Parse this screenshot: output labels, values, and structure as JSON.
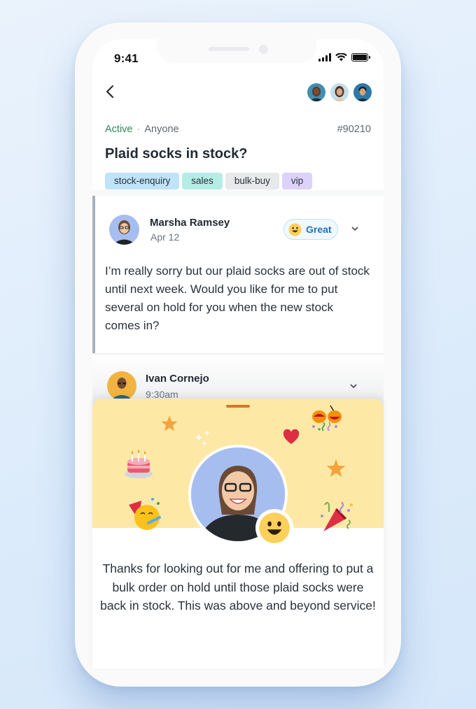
{
  "status_bar": {
    "time": "9:41"
  },
  "header": {
    "back_icon": "chevron-left-icon",
    "participants": [
      {
        "name": "participant-1",
        "color": "#2b6f8a"
      },
      {
        "name": "participant-2",
        "color": "#b9d6e2"
      },
      {
        "name": "participant-3",
        "color": "#2c79a8"
      }
    ]
  },
  "ticket": {
    "status": "Active",
    "separator": "·",
    "assignee": "Anyone",
    "id": "#90210",
    "title": "Plaid socks in stock?",
    "tags": [
      {
        "label": "stock-enquiry",
        "color": "#bfe3f8"
      },
      {
        "label": "sales",
        "color": "#b4ece6"
      },
      {
        "label": "bulk-buy",
        "color": "#e7e9eb"
      },
      {
        "label": "vip",
        "color": "#ddd2fa"
      }
    ]
  },
  "messages": [
    {
      "author": "Marsha Ramsey",
      "date": "Apr 12",
      "rating_label": "Great",
      "rating_icon": "grinning-face-icon",
      "body": "I’m really sorry but our plaid socks are out of stock until next week. Would you like for me to put several on hold for you when the new stock comes in?"
    },
    {
      "author": "Ivan Cornejo",
      "date": "9:30am"
    }
  ],
  "feedback_sheet": {
    "decorations": [
      "star-icon",
      "sparkles-icon",
      "heart-icon",
      "confetti-ball-icon",
      "birthday-cake-icon",
      "star-icon",
      "partying-face-icon",
      "party-popper-icon"
    ],
    "rating_icon": "grinning-face-icon",
    "quote": "Thanks for looking out for me and offering to put a bulk order on hold until those plaid socks were back in stock. This was above and beyond service!"
  },
  "colors": {
    "active": "#2f8a5a",
    "great_text": "#1d73b9",
    "banner": "#fde8a6",
    "handle": "#d27a2c"
  }
}
